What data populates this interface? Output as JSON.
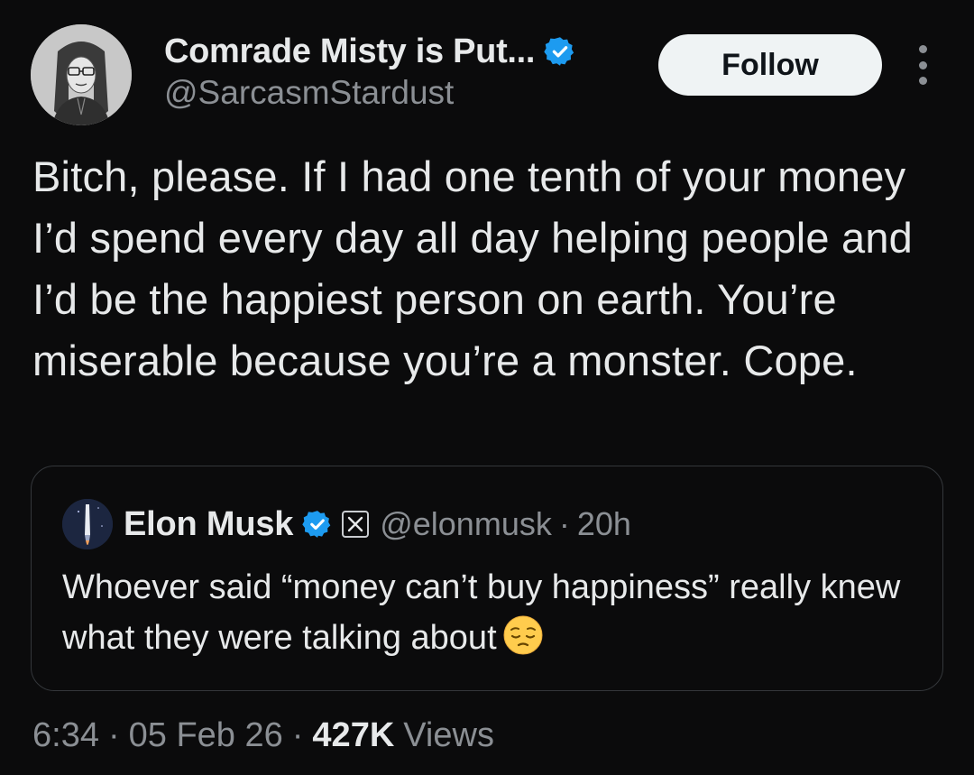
{
  "author": {
    "display_name": "Comrade Misty is Put...",
    "handle": "@SarcasmStardust",
    "verified": true
  },
  "actions": {
    "follow_label": "Follow"
  },
  "tweet": {
    "text": "Bitch, please. If I had one tenth of your money I’d spend every day all day helping people and I’d be the happiest person on earth. You’re miserable because you’re a monster. Cope."
  },
  "quoted_tweet": {
    "display_name": "Elon Musk",
    "handle": "@elonmusk",
    "separator": "·",
    "time": "20h",
    "text": "Whoever said “money can’t buy happiness” really knew what they were talking about",
    "emoji": "pensive-face"
  },
  "meta": {
    "time": "6:34",
    "separator": "·",
    "date": "05 Feb 26",
    "views_count": "427K",
    "views_label": "Views"
  },
  "colors": {
    "background": "#0b0b0c",
    "text_primary": "#e7e9ea",
    "text_secondary": "#8b8f94",
    "verified_blue": "#1d9bf0",
    "follow_button_bg": "#eff3f4"
  }
}
